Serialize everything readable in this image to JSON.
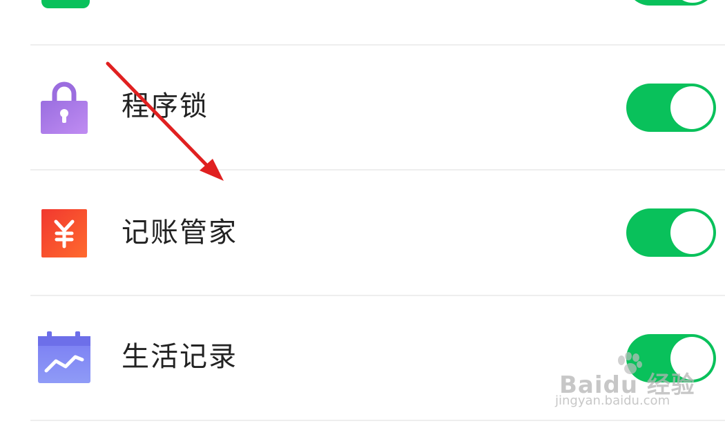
{
  "settings": {
    "items": [
      {
        "label": "程序锁",
        "icon": "lock-icon",
        "enabled": true
      },
      {
        "label": "记账管家",
        "icon": "yuan-icon",
        "enabled": true
      },
      {
        "label": "生活记录",
        "icon": "calendar-chart-icon",
        "enabled": true
      }
    ]
  },
  "watermark": {
    "brand": "Baidu 经验",
    "url": "jingyan.baidu.com"
  },
  "colors": {
    "toggle_on": "#09c15b",
    "arrow": "#e02020"
  }
}
